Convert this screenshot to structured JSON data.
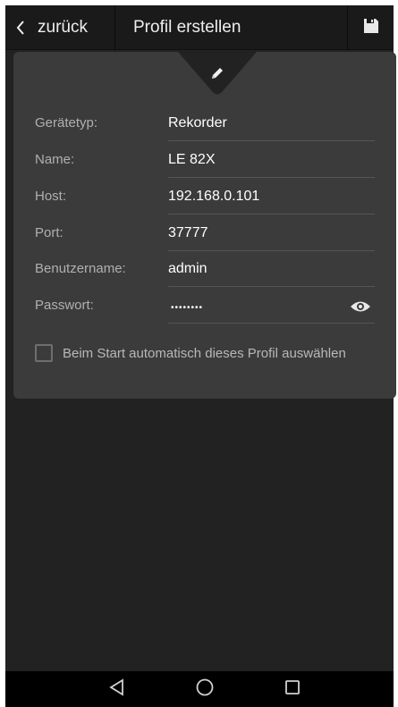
{
  "header": {
    "back_label": "zurück",
    "title": "Profil erstellen",
    "back_icon": "chevron-left-icon",
    "save_icon": "floppy-disk-icon"
  },
  "card": {
    "edit_icon": "pencil-icon",
    "fields": [
      {
        "label": "Gerätetyp:",
        "value": "Rekorder"
      },
      {
        "label": "Name:",
        "value": "LE 82X"
      },
      {
        "label": "Host:",
        "value": "192.168.0.101"
      },
      {
        "label": "Port:",
        "value": "37777"
      },
      {
        "label": "Benutzername:",
        "value": "admin"
      },
      {
        "label": "Passwort:",
        "value": "••••••••"
      }
    ],
    "password_toggle_icon": "eye-icon",
    "autoselect_label": "Beim Start automatisch dieses Profil auswählen",
    "autoselect_checked": false
  },
  "navbar": {
    "back_icon": "triangle-back-icon",
    "home_icon": "circle-home-icon",
    "recents_icon": "square-recents-icon"
  },
  "colors": {
    "background": "#222222",
    "card": "#3b3b3b",
    "topbar": "#1a1a1a",
    "text": "#ffffff",
    "label": "#b0b0b0"
  }
}
